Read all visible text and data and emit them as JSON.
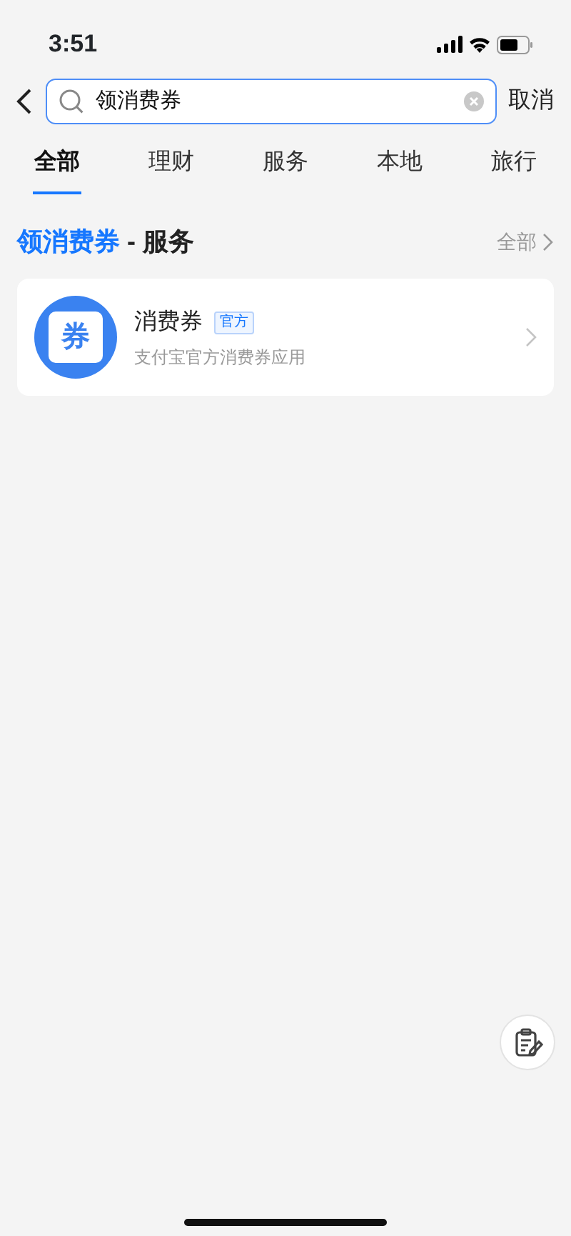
{
  "status_bar": {
    "time": "3:51"
  },
  "search": {
    "value": "领消费券",
    "cancel": "取消"
  },
  "tabs": [
    {
      "label": "全部",
      "selected": true
    },
    {
      "label": "理财",
      "selected": false
    },
    {
      "label": "服务",
      "selected": false
    },
    {
      "label": "本地",
      "selected": false
    },
    {
      "label": "旅行",
      "selected": false
    }
  ],
  "section": {
    "query": "领消费券",
    "suffix": " - 服务",
    "more": "全部"
  },
  "results": [
    {
      "logo_text": "券",
      "title": "消费券",
      "tag": "官方",
      "subtitle": "支付宝官方消费券应用"
    }
  ]
}
